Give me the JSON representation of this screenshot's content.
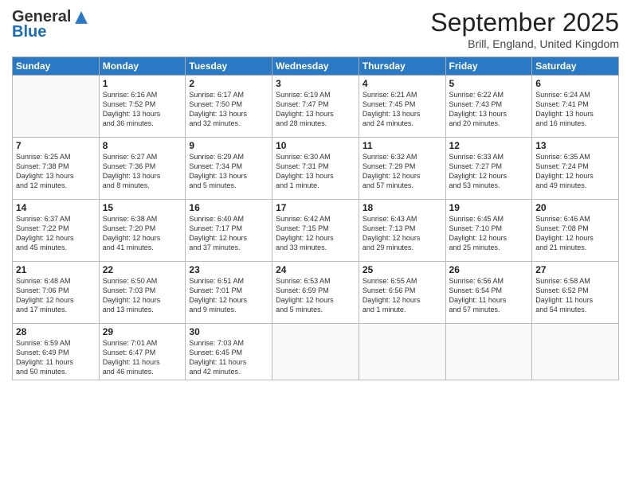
{
  "header": {
    "logo_line1": "General",
    "logo_line2": "Blue",
    "month": "September 2025",
    "location": "Brill, England, United Kingdom"
  },
  "days_of_week": [
    "Sunday",
    "Monday",
    "Tuesday",
    "Wednesday",
    "Thursday",
    "Friday",
    "Saturday"
  ],
  "weeks": [
    [
      {
        "day": "",
        "info": ""
      },
      {
        "day": "1",
        "info": "Sunrise: 6:16 AM\nSunset: 7:52 PM\nDaylight: 13 hours\nand 36 minutes."
      },
      {
        "day": "2",
        "info": "Sunrise: 6:17 AM\nSunset: 7:50 PM\nDaylight: 13 hours\nand 32 minutes."
      },
      {
        "day": "3",
        "info": "Sunrise: 6:19 AM\nSunset: 7:47 PM\nDaylight: 13 hours\nand 28 minutes."
      },
      {
        "day": "4",
        "info": "Sunrise: 6:21 AM\nSunset: 7:45 PM\nDaylight: 13 hours\nand 24 minutes."
      },
      {
        "day": "5",
        "info": "Sunrise: 6:22 AM\nSunset: 7:43 PM\nDaylight: 13 hours\nand 20 minutes."
      },
      {
        "day": "6",
        "info": "Sunrise: 6:24 AM\nSunset: 7:41 PM\nDaylight: 13 hours\nand 16 minutes."
      }
    ],
    [
      {
        "day": "7",
        "info": "Sunrise: 6:25 AM\nSunset: 7:38 PM\nDaylight: 13 hours\nand 12 minutes."
      },
      {
        "day": "8",
        "info": "Sunrise: 6:27 AM\nSunset: 7:36 PM\nDaylight: 13 hours\nand 8 minutes."
      },
      {
        "day": "9",
        "info": "Sunrise: 6:29 AM\nSunset: 7:34 PM\nDaylight: 13 hours\nand 5 minutes."
      },
      {
        "day": "10",
        "info": "Sunrise: 6:30 AM\nSunset: 7:31 PM\nDaylight: 13 hours\nand 1 minute."
      },
      {
        "day": "11",
        "info": "Sunrise: 6:32 AM\nSunset: 7:29 PM\nDaylight: 12 hours\nand 57 minutes."
      },
      {
        "day": "12",
        "info": "Sunrise: 6:33 AM\nSunset: 7:27 PM\nDaylight: 12 hours\nand 53 minutes."
      },
      {
        "day": "13",
        "info": "Sunrise: 6:35 AM\nSunset: 7:24 PM\nDaylight: 12 hours\nand 49 minutes."
      }
    ],
    [
      {
        "day": "14",
        "info": "Sunrise: 6:37 AM\nSunset: 7:22 PM\nDaylight: 12 hours\nand 45 minutes."
      },
      {
        "day": "15",
        "info": "Sunrise: 6:38 AM\nSunset: 7:20 PM\nDaylight: 12 hours\nand 41 minutes."
      },
      {
        "day": "16",
        "info": "Sunrise: 6:40 AM\nSunset: 7:17 PM\nDaylight: 12 hours\nand 37 minutes."
      },
      {
        "day": "17",
        "info": "Sunrise: 6:42 AM\nSunset: 7:15 PM\nDaylight: 12 hours\nand 33 minutes."
      },
      {
        "day": "18",
        "info": "Sunrise: 6:43 AM\nSunset: 7:13 PM\nDaylight: 12 hours\nand 29 minutes."
      },
      {
        "day": "19",
        "info": "Sunrise: 6:45 AM\nSunset: 7:10 PM\nDaylight: 12 hours\nand 25 minutes."
      },
      {
        "day": "20",
        "info": "Sunrise: 6:46 AM\nSunset: 7:08 PM\nDaylight: 12 hours\nand 21 minutes."
      }
    ],
    [
      {
        "day": "21",
        "info": "Sunrise: 6:48 AM\nSunset: 7:06 PM\nDaylight: 12 hours\nand 17 minutes."
      },
      {
        "day": "22",
        "info": "Sunrise: 6:50 AM\nSunset: 7:03 PM\nDaylight: 12 hours\nand 13 minutes."
      },
      {
        "day": "23",
        "info": "Sunrise: 6:51 AM\nSunset: 7:01 PM\nDaylight: 12 hours\nand 9 minutes."
      },
      {
        "day": "24",
        "info": "Sunrise: 6:53 AM\nSunset: 6:59 PM\nDaylight: 12 hours\nand 5 minutes."
      },
      {
        "day": "25",
        "info": "Sunrise: 6:55 AM\nSunset: 6:56 PM\nDaylight: 12 hours\nand 1 minute."
      },
      {
        "day": "26",
        "info": "Sunrise: 6:56 AM\nSunset: 6:54 PM\nDaylight: 11 hours\nand 57 minutes."
      },
      {
        "day": "27",
        "info": "Sunrise: 6:58 AM\nSunset: 6:52 PM\nDaylight: 11 hours\nand 54 minutes."
      }
    ],
    [
      {
        "day": "28",
        "info": "Sunrise: 6:59 AM\nSunset: 6:49 PM\nDaylight: 11 hours\nand 50 minutes."
      },
      {
        "day": "29",
        "info": "Sunrise: 7:01 AM\nSunset: 6:47 PM\nDaylight: 11 hours\nand 46 minutes."
      },
      {
        "day": "30",
        "info": "Sunrise: 7:03 AM\nSunset: 6:45 PM\nDaylight: 11 hours\nand 42 minutes."
      },
      {
        "day": "",
        "info": ""
      },
      {
        "day": "",
        "info": ""
      },
      {
        "day": "",
        "info": ""
      },
      {
        "day": "",
        "info": ""
      }
    ]
  ]
}
